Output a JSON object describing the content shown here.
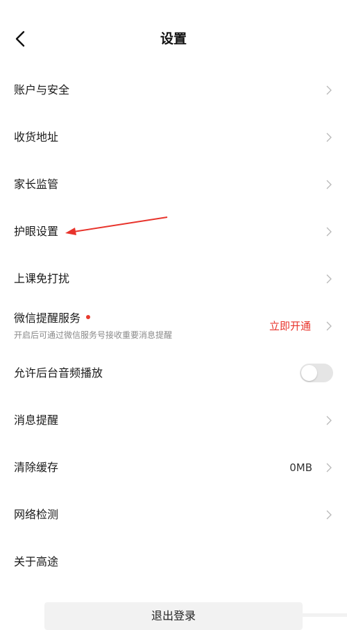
{
  "header": {
    "title": "设置",
    "back_icon": "chevron-left-icon"
  },
  "rows": [
    {
      "label": "账户与安全"
    },
    {
      "label": "收货地址"
    },
    {
      "label": "家长监管"
    },
    {
      "label": "护眼设置"
    },
    {
      "label": "上课免打扰"
    }
  ],
  "wechat": {
    "title": "微信提醒服务",
    "subtitle": "开启后可通过微信服务号接收重要消息提醒",
    "action": "立即开通",
    "dot_color": "#e83a2e",
    "action_color": "#e8332b"
  },
  "background_audio": {
    "label": "允许后台音频播放",
    "enabled": false
  },
  "rows_lower": [
    {
      "label": "消息提醒"
    },
    {
      "label": "清除缓存",
      "value": "0MB"
    },
    {
      "label": "网络检测"
    },
    {
      "label": "关于高途"
    }
  ],
  "logout": {
    "label": "退出登录"
  },
  "annotation": {
    "color": "#e8332b",
    "icon": "red-arrow-annotation"
  }
}
